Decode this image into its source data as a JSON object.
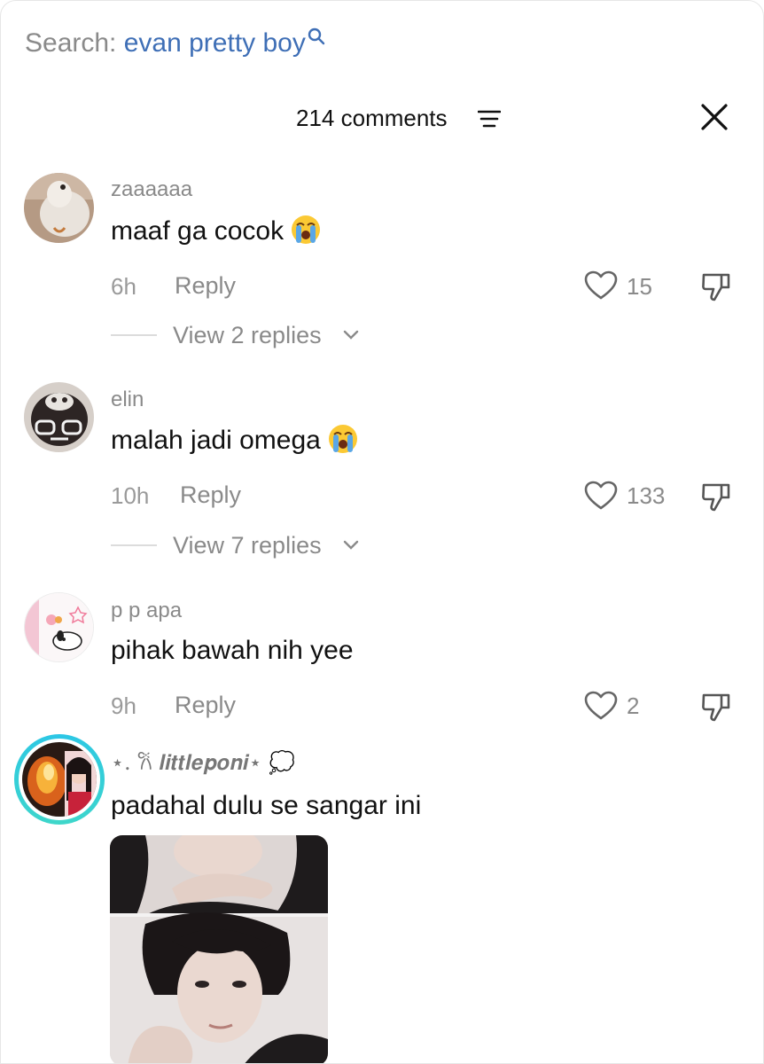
{
  "search": {
    "label": "Search:",
    "query": "evan pretty boy"
  },
  "header": {
    "comment_count": "214 comments"
  },
  "comments": [
    {
      "username": "zaaaaaa",
      "text": "maaf ga cocok",
      "emoji": "loudly-crying-face",
      "time": "6h",
      "reply_label": "Reply",
      "likes": "15",
      "view_replies": "View 2 replies"
    },
    {
      "username": "elin",
      "text": "malah jadi omega",
      "emoji": "loudly-crying-face",
      "time": "10h",
      "reply_label": "Reply",
      "likes": "133",
      "view_replies": "View 7 replies"
    },
    {
      "username": "p p apa",
      "text": "pihak bawah nih yee",
      "time": "9h",
      "reply_label": "Reply",
      "likes": "2"
    },
    {
      "username": "⋆. 𐙚 𝒍𝒊𝒕𝒕𝒍𝒆𝒑𝒐𝒏𝒊⋆ 💭",
      "text": "padahal dulu se sangar ini",
      "has_story_ring": true,
      "has_photo": true
    }
  ],
  "colors": {
    "query": "#3f6fb6",
    "muted": "#8a8a8a",
    "story_ring": "#2bc6e6"
  },
  "icons": [
    "search-icon",
    "sort-icon",
    "close-icon",
    "heart-icon",
    "dislike-icon",
    "chevron-down-icon"
  ]
}
